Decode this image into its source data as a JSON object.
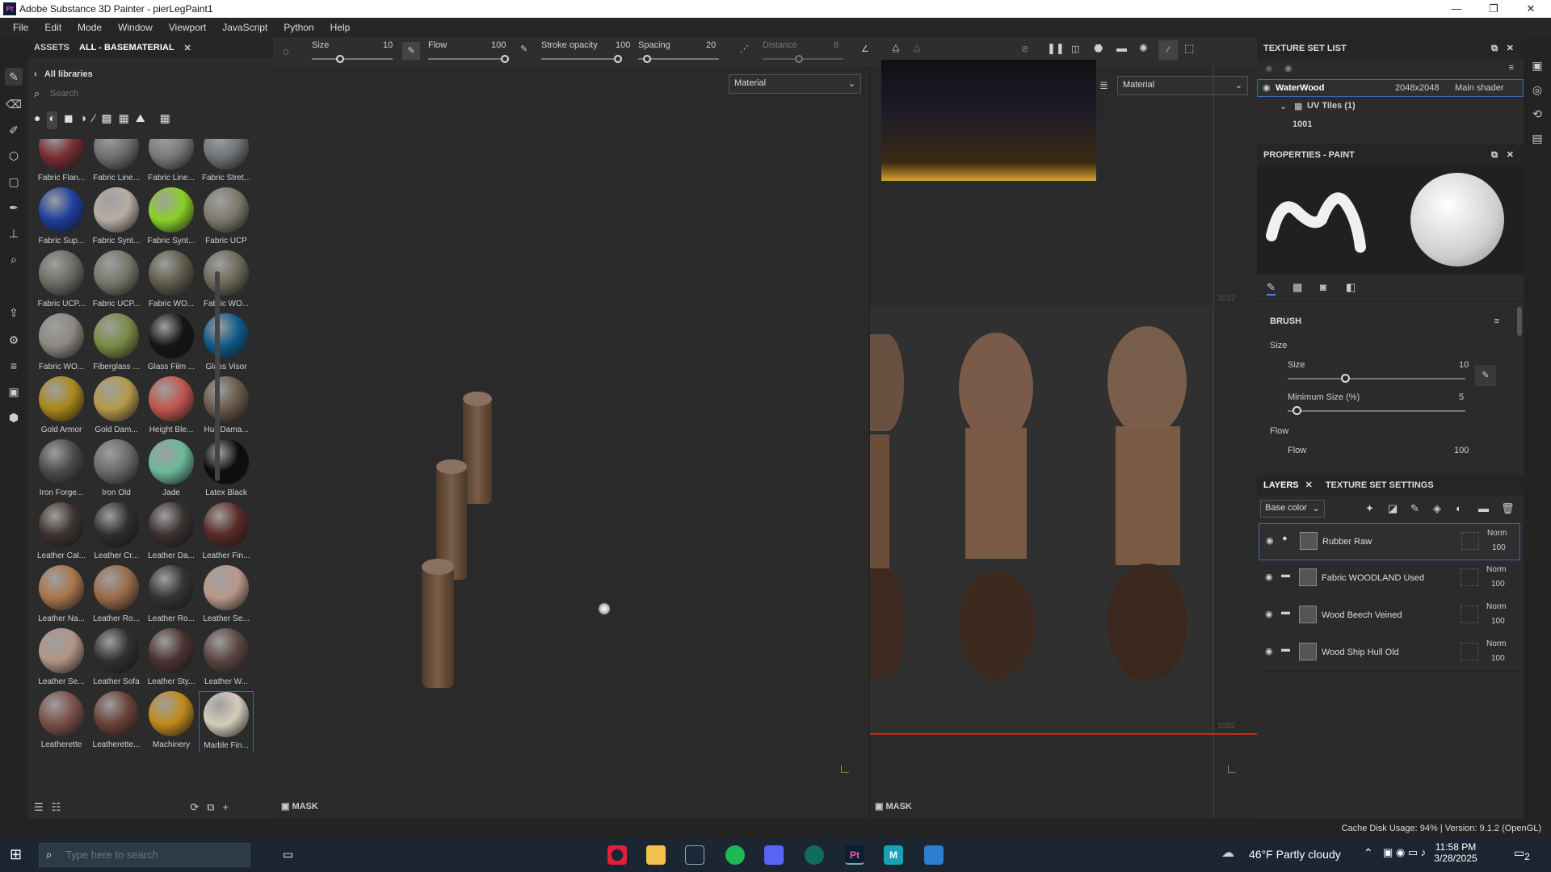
{
  "window": {
    "app_icon": "Pt",
    "title": "Adobe Substance 3D Painter - pierLegPaint1"
  },
  "menu": [
    "File",
    "Edit",
    "Mode",
    "Window",
    "Viewport",
    "JavaScript",
    "Python",
    "Help"
  ],
  "assets": {
    "tab1": "ASSETS",
    "tab2": "ALL - BASEMATERIAL",
    "library": "All libraries",
    "search_placeholder": "Search",
    "materials": [
      {
        "label": "Fabric Flan...",
        "color": "#7a2e33"
      },
      {
        "label": "Fabric Line...",
        "color": "#6f6f6f"
      },
      {
        "label": "Fabric Line...",
        "color": "#7a7a7a"
      },
      {
        "label": "Fabric Stret...",
        "color": "#707478"
      },
      {
        "label": "Fabric Sup...",
        "color": "#1f3e9e"
      },
      {
        "label": "Fabric Synt...",
        "color": "#b8ada4"
      },
      {
        "label": "Fabric Synt...",
        "color": "#8ad128"
      },
      {
        "label": "Fabric UCP",
        "color": "#7d7a6c"
      },
      {
        "label": "Fabric UCP...",
        "color": "#6b6d63"
      },
      {
        "label": "Fabric UCP...",
        "color": "#77766a"
      },
      {
        "label": "Fabric WO...",
        "color": "#5f5c4c"
      },
      {
        "label": "Fabric WO...",
        "color": "#6d6a58"
      },
      {
        "label": "Fabric WO...",
        "color": "#8a887f"
      },
      {
        "label": "Fiberglass ...",
        "color": "#7a8a43"
      },
      {
        "label": "Glass Film ...",
        "color": "#151515"
      },
      {
        "label": "Glass Visor",
        "color": "#0e5b8a"
      },
      {
        "label": "Gold Armor",
        "color": "#a8881a"
      },
      {
        "label": "Gold Dam...",
        "color": "#b59a4a"
      },
      {
        "label": "Height Ble...",
        "color": "#c0554e"
      },
      {
        "label": "Hull Dama...",
        "color": "#6a5a4a"
      },
      {
        "label": "Iron Forge...",
        "color": "#4a4a4a"
      },
      {
        "label": "Iron Old",
        "color": "#6a6a6a"
      },
      {
        "label": "Jade",
        "color": "#6ab89a"
      },
      {
        "label": "Latex Black",
        "color": "#0d0d0d"
      },
      {
        "label": "Leather Cal...",
        "color": "#3c342e"
      },
      {
        "label": "Leather Cr...",
        "color": "#2e2e2e"
      },
      {
        "label": "Leather Da...",
        "color": "#3a3030"
      },
      {
        "label": "Leather Fin...",
        "color": "#5a2a26"
      },
      {
        "label": "Leather Na...",
        "color": "#a8764a"
      },
      {
        "label": "Leather Ro...",
        "color": "#9a6a48"
      },
      {
        "label": "Leather Ro...",
        "color": "#343434"
      },
      {
        "label": "Leather Se...",
        "color": "#b8988a"
      },
      {
        "label": "Leather Se...",
        "color": "#b09484"
      },
      {
        "label": "Leather Sofa",
        "color": "#303030"
      },
      {
        "label": "Leather Sty...",
        "color": "#4a3432"
      },
      {
        "label": "Leather W...",
        "color": "#5a4440"
      },
      {
        "label": "Leatherette",
        "color": "#7a5048"
      },
      {
        "label": "Leatherette...",
        "color": "#6a4038"
      },
      {
        "label": "Machinery",
        "color": "#c08a1a"
      },
      {
        "label": "Marble Fin...",
        "color": "#d4ccbc"
      },
      {
        "label": "",
        "color": "#c8c2ba"
      },
      {
        "label": "",
        "color": "#1a2418"
      },
      {
        "label": "",
        "color": "#3a3a3a"
      },
      {
        "label": "",
        "color": "#2a2a2a"
      }
    ]
  },
  "toolbar": {
    "size_label": "Size",
    "size_value": "10",
    "flow_label": "Flow",
    "flow_value": "100",
    "stroke_label": "Stroke opacity",
    "stroke_value": "100",
    "spacing_label": "Spacing",
    "spacing_value": "20",
    "distance_label": "Distance",
    "distance_value": "8"
  },
  "viewport": {
    "left_dropdown": "Material",
    "right_dropdown": "Material",
    "mask_left": "MASK",
    "mask_right": "MASK",
    "uv_top": "1012",
    "uv_bottom": "1002"
  },
  "texture_set": {
    "title": "TEXTURE SET LIST",
    "name": "WaterWood",
    "resolution": "2048x2048",
    "shader": "Main shader",
    "uv_tiles": "UV Tiles (1)",
    "tile": "1001"
  },
  "properties": {
    "title": "PROPERTIES - PAINT",
    "brush": "BRUSH",
    "size_section": "Size",
    "size_label": "Size",
    "size_value": "10",
    "min_size_label": "Minimum Size (%)",
    "min_size_value": "5",
    "flow_section": "Flow",
    "flow_label": "Flow",
    "flow_value": "100"
  },
  "layers": {
    "tab1": "LAYERS",
    "tab2": "TEXTURE SET SETTINGS",
    "channel": "Base color",
    "items": [
      {
        "name": "Rubber Raw",
        "blend": "Norm",
        "opacity": "100"
      },
      {
        "name": "Fabric WOODLAND Used",
        "blend": "Norm",
        "opacity": "100"
      },
      {
        "name": "Wood Beech Veined",
        "blend": "Norm",
        "opacity": "100"
      },
      {
        "name": "Wood Ship Hull Old",
        "blend": "Norm",
        "opacity": "100"
      }
    ]
  },
  "status": "Cache Disk Usage:   94%  |  Version: 9.1.2 (OpenGL)",
  "taskbar": {
    "search_placeholder": "Type here to search",
    "weather": "46°F  Partly cloudy",
    "time": "11:58 PM",
    "date": "3/28/2025",
    "notif": "2"
  }
}
